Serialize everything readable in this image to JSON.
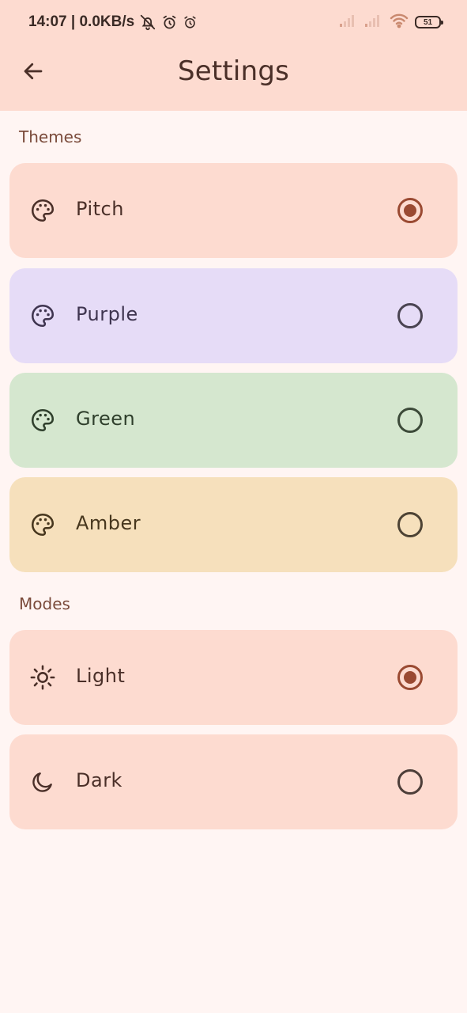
{
  "status_bar": {
    "time_speed": "14:07 | 0.0KB/s",
    "battery": "51",
    "icons": [
      "notifications-off-icon",
      "alarm-icon",
      "alarm-icon",
      "signal-icon",
      "signal-icon",
      "wifi-icon",
      "battery-icon"
    ]
  },
  "header": {
    "title": "Settings",
    "back_icon": "arrow-left-icon"
  },
  "themes": {
    "label": "Themes",
    "items": [
      {
        "label": "Pitch",
        "icon": "palette-icon",
        "selected": true,
        "bg": "#fddbd0",
        "fg": "#4a2f28"
      },
      {
        "label": "Purple",
        "icon": "palette-icon",
        "selected": false,
        "bg": "#e6dcf7",
        "fg": "#3f3550"
      },
      {
        "label": "Green",
        "icon": "palette-icon",
        "selected": false,
        "bg": "#d5e7cf",
        "fg": "#2f3f2c"
      },
      {
        "label": "Amber",
        "icon": "palette-icon",
        "selected": false,
        "bg": "#f6e0bc",
        "fg": "#47371e"
      }
    ]
  },
  "modes": {
    "label": "Modes",
    "items": [
      {
        "label": "Light",
        "icon": "sun-icon",
        "selected": true,
        "bg": "#fddbd0",
        "fg": "#4a2f28"
      },
      {
        "label": "Dark",
        "icon": "moon-icon",
        "selected": false,
        "bg": "#fddbd0",
        "fg": "#4a2f28"
      }
    ]
  },
  "colors": {
    "accent": "#9a4a32",
    "app_bar": "#fddbd0",
    "background": "#fff5f3"
  }
}
